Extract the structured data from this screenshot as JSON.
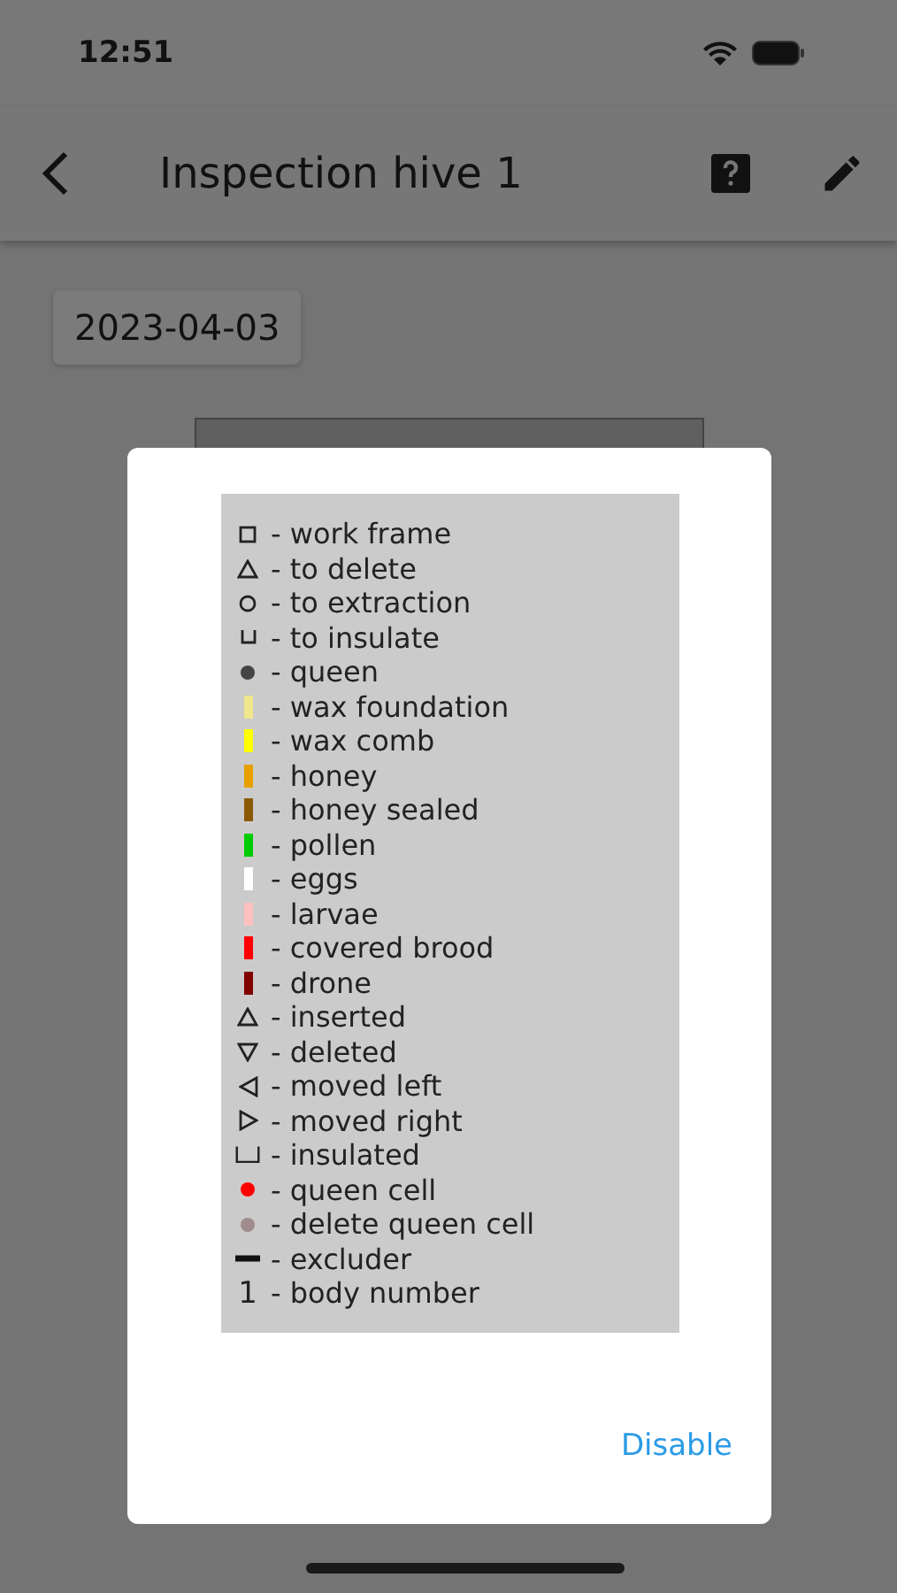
{
  "status_bar": {
    "time": "12:51"
  },
  "app_bar": {
    "title": "Inspection hive 1"
  },
  "date_chip": "2023-04-03",
  "dialog": {
    "legend": [
      {
        "kind": "square",
        "label": "- work frame"
      },
      {
        "kind": "triangle-up",
        "label": "- to delete"
      },
      {
        "kind": "circle",
        "label": "- to extraction"
      },
      {
        "kind": "cup",
        "label": "- to insulate"
      },
      {
        "kind": "dot",
        "color": "#444444",
        "label": "- queen"
      },
      {
        "kind": "bar",
        "color": "#f0e68c",
        "label": "- wax foundation"
      },
      {
        "kind": "bar",
        "color": "#ffff00",
        "label": "- wax comb"
      },
      {
        "kind": "bar",
        "color": "#e8a000",
        "label": "- honey"
      },
      {
        "kind": "bar",
        "color": "#8b5a00",
        "label": "- honey sealed"
      },
      {
        "kind": "bar",
        "color": "#00cc00",
        "label": "- pollen"
      },
      {
        "kind": "bar",
        "color": "#ffffff",
        "label": "- eggs"
      },
      {
        "kind": "bar",
        "color": "#ffc0c0",
        "label": "- larvae"
      },
      {
        "kind": "bar",
        "color": "#ff0000",
        "label": "- covered brood"
      },
      {
        "kind": "bar",
        "color": "#800000",
        "label": "- drone"
      },
      {
        "kind": "triangle-up",
        "label": "- inserted"
      },
      {
        "kind": "triangle-down",
        "label": "- deleted"
      },
      {
        "kind": "triangle-left",
        "label": "- moved left"
      },
      {
        "kind": "triangle-right",
        "label": "- moved right"
      },
      {
        "kind": "bracket",
        "label": "- insulated"
      },
      {
        "kind": "dot",
        "color": "#ff0000",
        "label": "- queen cell"
      },
      {
        "kind": "dot",
        "color": "#a08c8c",
        "label": "- delete queen cell"
      },
      {
        "kind": "line",
        "label": "- excluder"
      },
      {
        "kind": "text",
        "marker": "1",
        "label": "- body number"
      }
    ],
    "button": "Disable"
  }
}
